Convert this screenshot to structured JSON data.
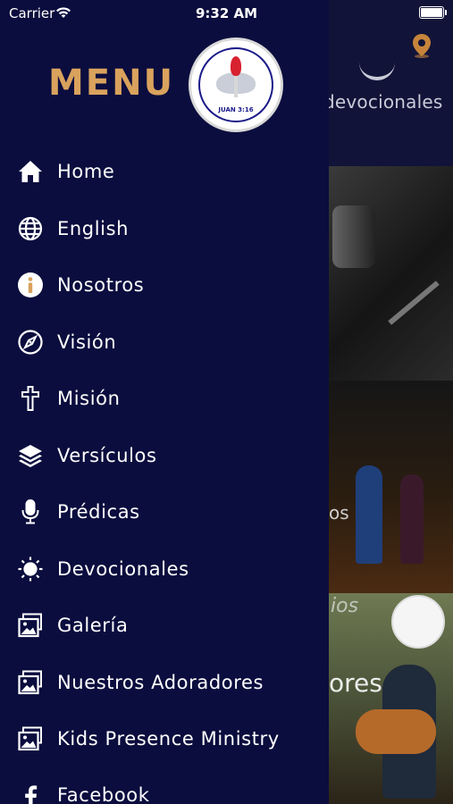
{
  "status_bar": {
    "carrier": "Carrier",
    "time": "9:32 AM"
  },
  "drawer": {
    "title": "MENU",
    "logo_text": "JUAN 3:16",
    "items": [
      {
        "label": "Home",
        "icon": "home-icon"
      },
      {
        "label": "English",
        "icon": "globe-icon"
      },
      {
        "label": "Nosotros",
        "icon": "info-icon"
      },
      {
        "label": "Visión",
        "icon": "compass-icon"
      },
      {
        "label": "Misión",
        "icon": "cross-icon"
      },
      {
        "label": "Versículos",
        "icon": "layers-icon"
      },
      {
        "label": "Prédicas",
        "icon": "microphone-icon"
      },
      {
        "label": "Devocionales",
        "icon": "sun-icon"
      },
      {
        "label": "Galería",
        "icon": "gallery-icon"
      },
      {
        "label": "Nuestros Adoradores",
        "icon": "gallery-icon"
      },
      {
        "label": "Kids Presence Ministry",
        "icon": "gallery-icon"
      },
      {
        "label": "Facebook",
        "icon": "facebook-icon"
      }
    ]
  },
  "background": {
    "header_label": "devocionales",
    "card2_text": "os",
    "card3_text": "ores",
    "card3_text2": "ios"
  },
  "colors": {
    "drawer_bg": "#0b0d3e",
    "accent": "#d9a25d",
    "text": "#ffffff"
  }
}
